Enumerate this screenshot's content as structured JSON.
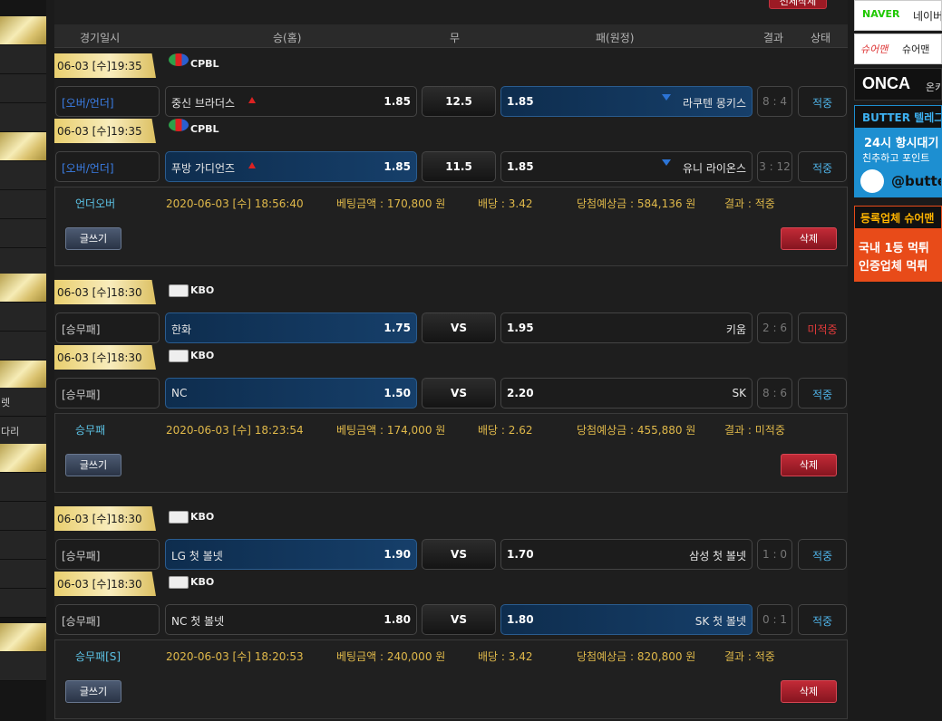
{
  "left_menu": [
    "렛",
    "다리"
  ],
  "top_button": "전체삭제",
  "header": {
    "date": "경기일시",
    "home": "승(홈)",
    "draw": "무",
    "away": "패(원정)",
    "result": "결과",
    "status": "상태"
  },
  "bets": [
    {
      "games": [
        {
          "datetime": "06-03 [수]19:35",
          "league": "CPBL",
          "type": "[오버/언더]",
          "type_style": "ou",
          "home": "중신 브라더스",
          "home_odds": "1.85",
          "home_mark": "up",
          "draw": "12.5",
          "away": "라쿠텐 몽키스",
          "away_odds": "1.85",
          "away_mark": "down",
          "selected": "away",
          "score": "8 : 4",
          "status": "적중",
          "miss": false
        },
        {
          "datetime": "06-03 [수]19:35",
          "league": "CPBL",
          "type": "[오버/언더]",
          "type_style": "ou",
          "home": "푸방 가디언즈",
          "home_odds": "1.85",
          "home_mark": "up",
          "draw": "11.5",
          "away": "유니 라이온스",
          "away_odds": "1.85",
          "away_mark": "down",
          "selected": "home",
          "score": "3 : 12",
          "status": "적중",
          "miss": false
        }
      ],
      "summary": {
        "bet_type": "언더오버",
        "time": "2020-06-03 [수] 18:56:40",
        "amount": "베팅금액 : 170,800 원",
        "rate": "배당 : 3.42",
        "expected": "당첨예상금 : 584,136 원",
        "result": "결과 : 적중"
      }
    },
    {
      "games": [
        {
          "datetime": "06-03 [수]18:30",
          "league": "KBO",
          "type": "[승무패]",
          "type_style": "",
          "home": "한화",
          "home_odds": "1.75",
          "home_mark": "",
          "draw": "VS",
          "away": "키움",
          "away_odds": "1.95",
          "away_mark": "",
          "selected": "home",
          "score": "2 : 6",
          "status": "미적중",
          "miss": true
        },
        {
          "datetime": "06-03 [수]18:30",
          "league": "KBO",
          "type": "[승무패]",
          "type_style": "",
          "home": "NC",
          "home_odds": "1.50",
          "home_mark": "",
          "draw": "VS",
          "away": "SK",
          "away_odds": "2.20",
          "away_mark": "",
          "selected": "home",
          "score": "8 : 6",
          "status": "적중",
          "miss": false
        }
      ],
      "summary": {
        "bet_type": "승무패",
        "time": "2020-06-03 [수] 18:23:54",
        "amount": "베팅금액 : 174,000 원",
        "rate": "배당 : 2.62",
        "expected": "당첨예상금 : 455,880 원",
        "result": "결과 : 미적중"
      }
    },
    {
      "games": [
        {
          "datetime": "06-03 [수]18:30",
          "league": "KBO",
          "type": "[승무패]",
          "type_style": "",
          "home": "LG 첫 볼넷",
          "home_odds": "1.90",
          "home_mark": "",
          "draw": "VS",
          "away": "삼성 첫 볼넷",
          "away_odds": "1.70",
          "away_mark": "",
          "selected": "home",
          "score": "1 : 0",
          "status": "적중",
          "miss": false
        },
        {
          "datetime": "06-03 [수]18:30",
          "league": "KBO",
          "type": "[승무패]",
          "type_style": "",
          "home": "NC 첫 볼넷",
          "home_odds": "1.80",
          "home_mark": "",
          "draw": "VS",
          "away": "SK 첫 볼넷",
          "away_odds": "1.80",
          "away_mark": "",
          "selected": "away",
          "score": "0 : 1",
          "status": "적중",
          "miss": false
        }
      ],
      "summary": {
        "bet_type": "승무패[S]",
        "time": "2020-06-03 [수] 18:20:53",
        "amount": "베팅금액 : 240,000 원",
        "rate": "배당 : 3.42",
        "expected": "당첨예상금 : 820,800 원",
        "result": "결과 : 적중"
      }
    }
  ],
  "buttons": {
    "write": "글쓰기",
    "delete": "삭제"
  },
  "ads": {
    "naver": {
      "logo": "NAVER",
      "text": "네이버"
    },
    "sugar": {
      "logo": "슈어맨",
      "text": "슈어맨"
    },
    "onca": {
      "logo": "ONCA",
      "text": "온카"
    },
    "butter": {
      "title": "BUTTER 텔레그",
      "line1": "24시 항시대기",
      "line2": "친추하고 포인트",
      "handle": "@butte"
    },
    "registered": {
      "title": "등록업체 슈어맨",
      "line1": "국내 1등 먹튀",
      "line2": "인증업체 먹튀"
    }
  },
  "colors": {
    "gold": "#e9cf6f",
    "hit": "#4fb3e8",
    "miss": "#e23b3b",
    "selected": "#163f6a",
    "over_under": "#3b7ee6"
  }
}
